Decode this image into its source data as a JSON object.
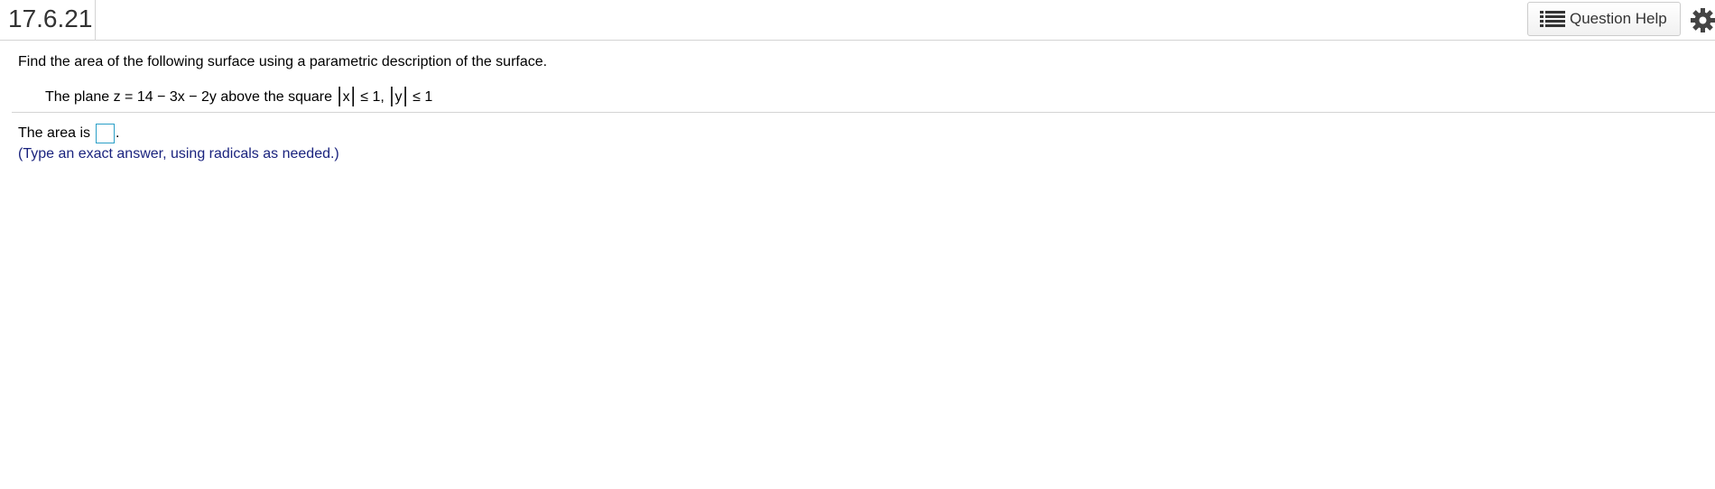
{
  "header": {
    "question_number": "17.6.21",
    "help_button_label": "Question Help",
    "help_icon": "list-icon",
    "settings_icon": "gear-icon"
  },
  "question": {
    "prompt": "Find the area of the following surface using a parametric description of the surface.",
    "problem_prefix": "The plane z = 14 − 3x − 2y above the square ",
    "abs_x": "x",
    "abs_sep": " ≤ 1,  ",
    "abs_y": "y",
    "abs_end": " ≤ 1"
  },
  "answer": {
    "label": "The area is",
    "value": "",
    "suffix": ".",
    "instruction": "(Type an exact answer, using radicals as needed.)"
  },
  "colors": {
    "instruction_text": "#1a237e",
    "input_border": "#2a9fc7",
    "divider": "#d4d4d4"
  }
}
